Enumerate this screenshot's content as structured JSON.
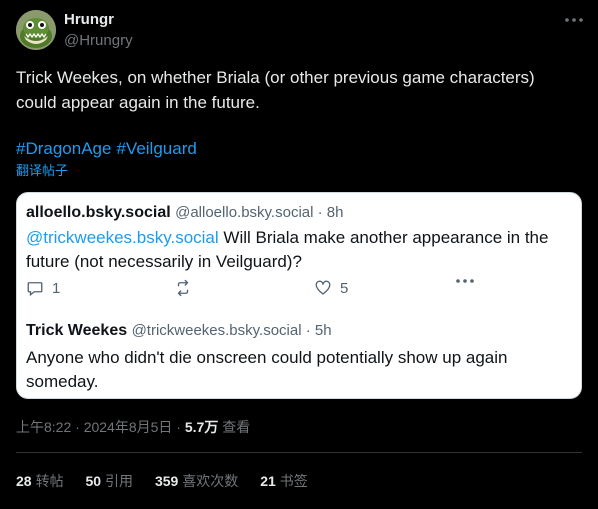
{
  "author": {
    "name": "Hrungr",
    "handle": "@Hrungry"
  },
  "tweet": {
    "text": "Trick Weekes, on whether Briala (or other previous game characters) could appear again in the future.",
    "hashtags": [
      "#DragonAge",
      "#Veilguard"
    ],
    "translate_label": "翻译帖子"
  },
  "quoted": {
    "post1": {
      "name": "alloello.bsky.social",
      "handle_time": "@alloello.bsky.social · 8h",
      "mention": "@trickweekes.bsky.social",
      "text": " Will Briala make another appearance in the future (not necessarily in Veilguard)?",
      "replies": "1",
      "likes": "5"
    },
    "post2": {
      "name": "Trick Weekes",
      "handle_time": "@trickweekes.bsky.social · 5h",
      "text": "Anyone who didn't die onscreen could potentially show up again someday."
    }
  },
  "meta": {
    "timestamp": "上午8:22 · 2024年8月5日 · ",
    "views_count": "5.7万",
    "views_label": " 查看"
  },
  "stats": [
    {
      "num": "28",
      "label": "转帖"
    },
    {
      "num": "50",
      "label": "引用"
    },
    {
      "num": "359",
      "label": "喜欢次数"
    },
    {
      "num": "21",
      "label": "书签"
    }
  ],
  "colors": {
    "background": "#000000",
    "link": "#1d9bf0",
    "muted": "#71767b",
    "quote_bg": "#ffffff"
  }
}
